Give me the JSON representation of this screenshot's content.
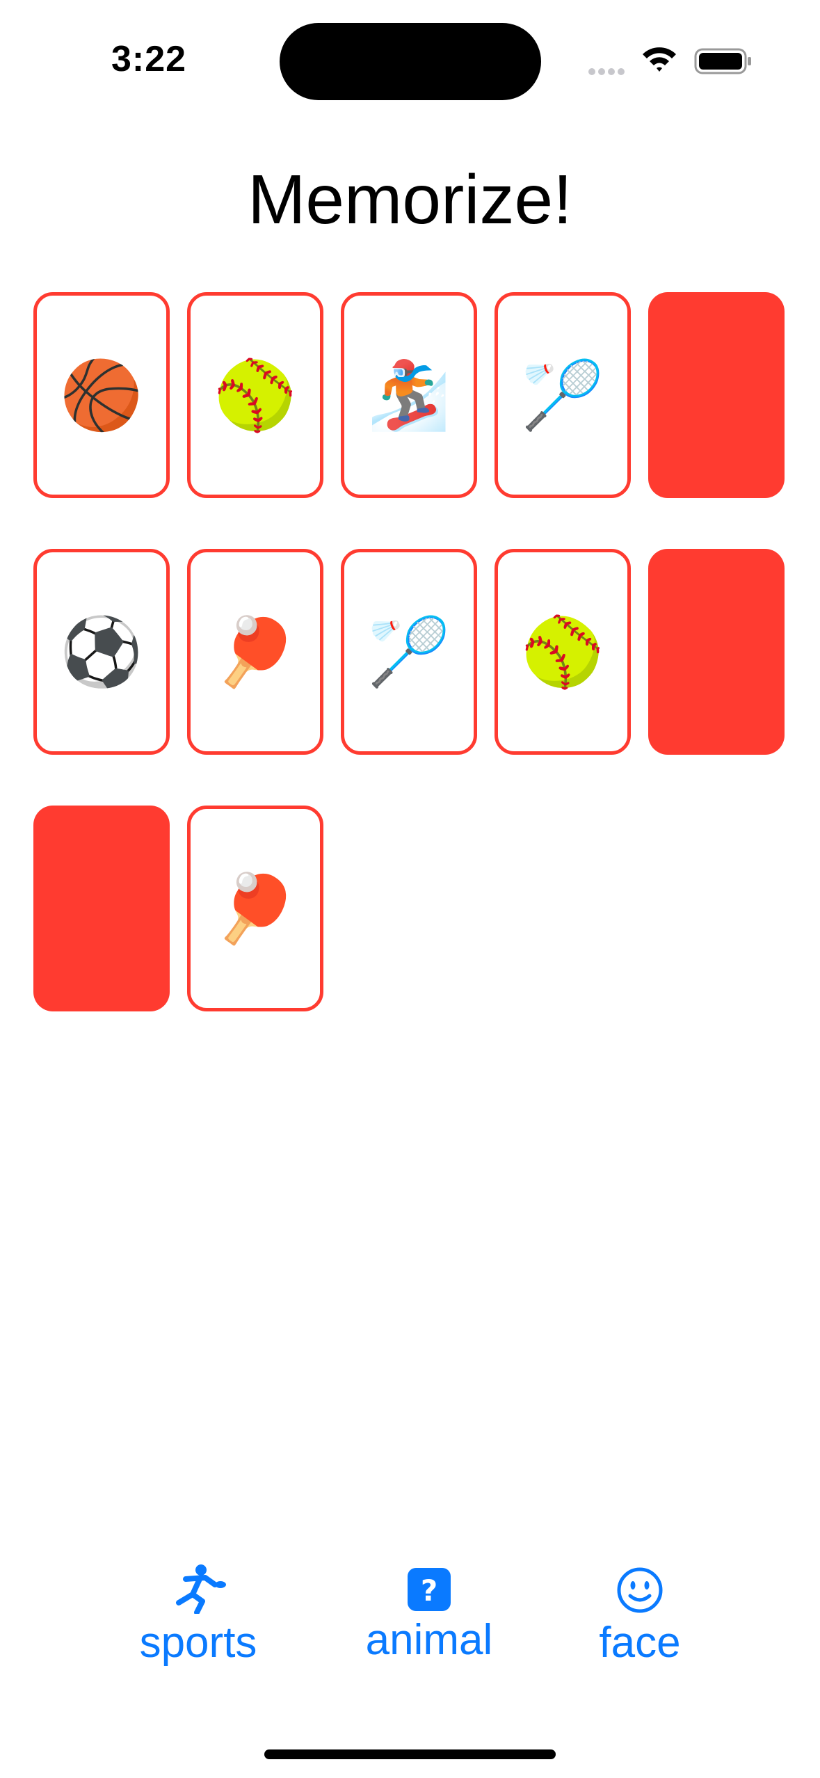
{
  "status_bar": {
    "time": "3:22"
  },
  "title": "Memorize!",
  "cards": [
    {
      "emoji": "🏀",
      "face_up": true
    },
    {
      "emoji": "🥎",
      "face_up": true
    },
    {
      "emoji": "🏂",
      "face_up": true
    },
    {
      "emoji": "🏸",
      "face_up": true
    },
    {
      "emoji": "",
      "face_up": false
    },
    {
      "emoji": "⚽",
      "face_up": true
    },
    {
      "emoji": "🏓",
      "face_up": true
    },
    {
      "emoji": "🏸",
      "face_up": true
    },
    {
      "emoji": "🥎",
      "face_up": true
    },
    {
      "emoji": "",
      "face_up": false
    },
    {
      "emoji": "",
      "face_up": false
    },
    {
      "emoji": "🏓",
      "face_up": true
    }
  ],
  "theme_buttons": [
    {
      "label": "sports",
      "icon": "figure-kickball-icon"
    },
    {
      "label": "animal",
      "icon": "questionmark-square-icon"
    },
    {
      "label": "face",
      "icon": "smiley-icon"
    }
  ],
  "colors": {
    "card": "#ff3b30",
    "accent": "#0a7aff"
  }
}
